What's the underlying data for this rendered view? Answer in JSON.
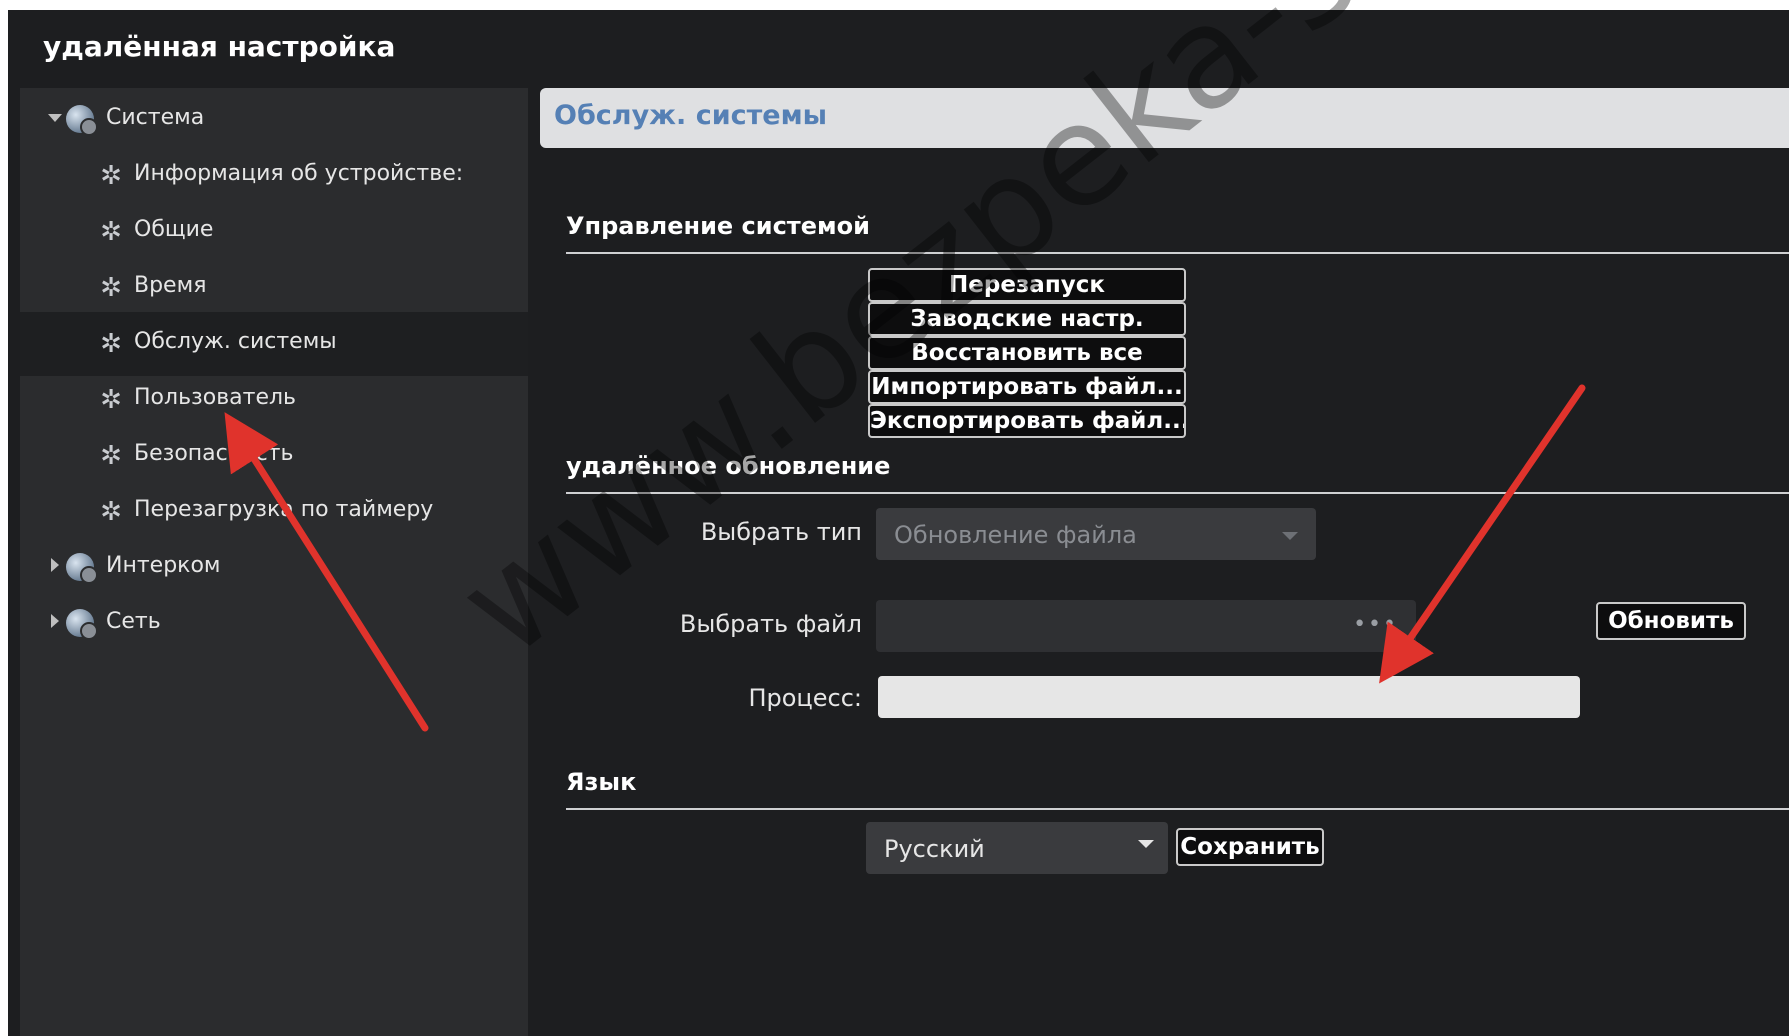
{
  "app": {
    "title": "удалённая настройка"
  },
  "sidebar": {
    "items": [
      {
        "label": "Система",
        "level": 0,
        "expanded": true,
        "icon": "globe-gear-icon"
      },
      {
        "label": "Информация об устройстве:",
        "level": 1,
        "icon": "gear-icon"
      },
      {
        "label": "Общие",
        "level": 1,
        "icon": "gear-icon"
      },
      {
        "label": "Время",
        "level": 1,
        "icon": "gear-icon"
      },
      {
        "label": "Обслуж. системы",
        "level": 1,
        "selected": true,
        "icon": "gear-icon"
      },
      {
        "label": "Пользователь",
        "level": 1,
        "icon": "gear-icon"
      },
      {
        "label": "Безопасность",
        "level": 1,
        "icon": "gear-icon"
      },
      {
        "label": "Перезагрузка по таймеру",
        "level": 1,
        "icon": "gear-icon"
      },
      {
        "label": "Интерком",
        "level": 0,
        "expanded": false,
        "icon": "globe-gear-icon"
      },
      {
        "label": "Сеть",
        "level": 0,
        "expanded": false,
        "icon": "globe-gear-icon"
      }
    ]
  },
  "main": {
    "header_title": "Обслуж. системы",
    "system_management": {
      "title": "Управление системой",
      "buttons": [
        "Перезапуск",
        "Заводские настр.",
        "Восстановить все",
        "Импортировать файл...",
        "Экспортировать файл..."
      ]
    },
    "remote_update": {
      "title": "удалённое обновление",
      "type_label": "Выбрать тип",
      "type_value": "Обновление файла",
      "file_label": "Выбрать файл",
      "browse_label": "•••",
      "update_button": "Обновить",
      "process_label": "Процесс:",
      "progress": 0
    },
    "language": {
      "title": "Язык",
      "selected": "Русский",
      "save_button": "Сохранить"
    }
  },
  "watermark": "www.bezpeka-shop.com",
  "colors": {
    "accent": "#5580b5",
    "annotation_arrow": "#e0332c",
    "panel": "#2b2c2e",
    "background": "#1d1e20"
  }
}
